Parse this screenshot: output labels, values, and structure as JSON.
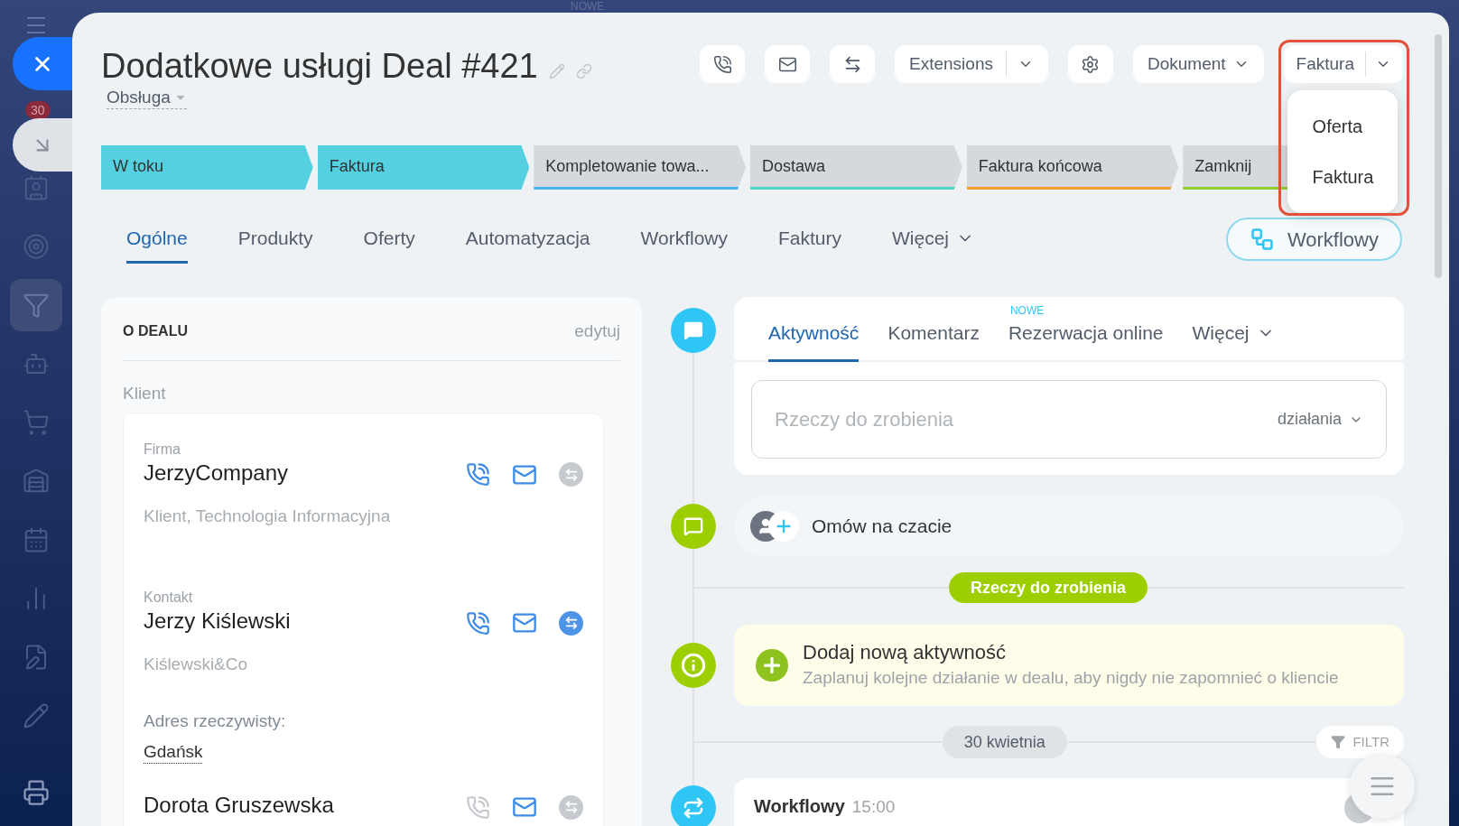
{
  "background_label": "NOWE",
  "sidebar": {
    "badge": "30",
    "items": [
      {
        "kind": "contacts",
        "selected": false
      },
      {
        "kind": "target",
        "selected": false
      },
      {
        "kind": "funnel",
        "selected": true
      },
      {
        "kind": "robot",
        "selected": false
      },
      {
        "kind": "cart",
        "selected": false
      },
      {
        "kind": "warehouse",
        "selected": false
      },
      {
        "kind": "calendar",
        "selected": false
      },
      {
        "kind": "chart",
        "selected": false
      },
      {
        "kind": "document",
        "selected": false
      },
      {
        "kind": "pencil",
        "selected": false
      }
    ]
  },
  "header": {
    "title": "Dodatkowe usługi Deal #421",
    "category": "Obsługa",
    "extensions": "Extensions",
    "document": "Dokument",
    "invoice": {
      "label": "Faktura",
      "expanded": true,
      "menu": [
        "Oferta",
        "Faktura"
      ]
    }
  },
  "stages": [
    {
      "label": "W toku",
      "reached": true,
      "color": "#55d0e0"
    },
    {
      "label": "Faktura",
      "reached": true,
      "color": "#55d0e0"
    },
    {
      "label": "Kompletowanie towa...",
      "reached": false,
      "color": "#47b4ee"
    },
    {
      "label": "Dostawa",
      "reached": false,
      "color": "#4fd6c6"
    },
    {
      "label": "Faktura końcowa",
      "reached": false,
      "color": "#f0a12b"
    },
    {
      "label": "Zamknij",
      "reached": false,
      "color": "#8fcf2d"
    }
  ],
  "tabs": [
    {
      "label": "Ogólne",
      "selected": true,
      "dropdown": false
    },
    {
      "label": "Produkty",
      "selected": false,
      "dropdown": false
    },
    {
      "label": "Oferty",
      "selected": false,
      "dropdown": false
    },
    {
      "label": "Automatyzacja",
      "selected": false,
      "dropdown": false
    },
    {
      "label": "Workflowy",
      "selected": false,
      "dropdown": false
    },
    {
      "label": "Faktury",
      "selected": false,
      "dropdown": false
    },
    {
      "label": "Więcej",
      "selected": false,
      "dropdown": true
    }
  ],
  "workflow_button": "Workflowy",
  "deal_card": {
    "title": "O DEALU",
    "edit": "edytuj",
    "section": "Klient",
    "entries": [
      {
        "kind": "contact",
        "label": "Firma",
        "name": "JerzyCompany",
        "detail": "Klient, Technologia Informacyjna",
        "phone_active": true,
        "email_active": true,
        "chat_active": false
      },
      {
        "kind": "contact",
        "label": "Kontakt",
        "name": "Jerzy Kiślewski",
        "detail": "Kiślewski&Co",
        "phone_active": true,
        "email_active": true,
        "chat_active": true
      },
      {
        "kind": "address",
        "label": "Adres rzeczywisty:",
        "value": "Gdańsk"
      },
      {
        "kind": "contact",
        "name": "Dorota Gruszewska",
        "phone_active": false,
        "email_active": true,
        "chat_active": false
      }
    ]
  },
  "composer": {
    "tabs": [
      {
        "label": "Aktywność",
        "selected": true
      },
      {
        "label": "Komentarz",
        "selected": false
      },
      {
        "label": "Rezerwacja online",
        "selected": false,
        "badge": "NOWE"
      },
      {
        "label": "Więcej",
        "selected": false,
        "dropdown": true
      }
    ],
    "placeholder": "Rzeczy do zrobienia",
    "action": "działania"
  },
  "chat_row": "Omów na czacie",
  "todo_pill": "Rzeczy do zrobienia",
  "add_activity": {
    "title": "Dodaj nową aktywność",
    "description": "Zaplanuj kolejne działanie w dealu, aby nigdy nie zapomnieć o kliencie"
  },
  "date_pill": "30 kwietnia",
  "filter": "FILTR",
  "history": [
    {
      "title": "Workflowy",
      "time": "15:00"
    }
  ]
}
